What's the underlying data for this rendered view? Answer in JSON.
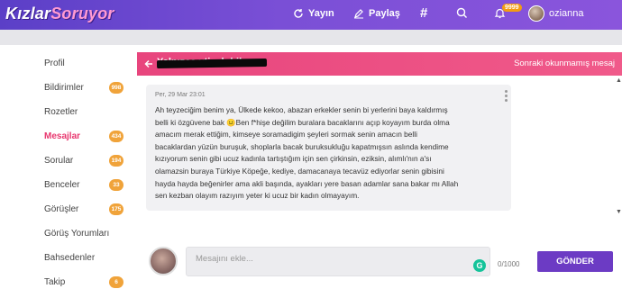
{
  "topbar": {
    "logo_part1": "Kızlar",
    "logo_part2": "Soruyor",
    "nav": {
      "yayin": "Yayın",
      "paylas": "Paylaş",
      "hash": "#"
    },
    "notifications_badge": "9999",
    "username": "ozianna"
  },
  "sidebar": {
    "items": [
      {
        "label": "Profil",
        "badge": ""
      },
      {
        "label": "Bildirimler",
        "badge": "998"
      },
      {
        "label": "Rozetler",
        "badge": ""
      },
      {
        "label": "Mesajlar",
        "badge": "434"
      },
      {
        "label": "Sorular",
        "badge": "194"
      },
      {
        "label": "Benceler",
        "badge": "33"
      },
      {
        "label": "Görüşler",
        "badge": "175"
      },
      {
        "label": "Görüş Yorumları",
        "badge": ""
      },
      {
        "label": "Bahsedenler",
        "badge": ""
      },
      {
        "label": "Takip",
        "badge": "6"
      }
    ]
  },
  "conversation": {
    "title": "Yalnızca ytisch bik",
    "next_unread": "Sonraki okunmamış mesaj",
    "message": {
      "date": "Per, 29 Mar 23:01",
      "lines": [
        "Ah teyzeciğim benim ya, Ülkede kekoo, abazan erkekler senin bi yerlerini baya kaldırmış",
        "belli ki özgüvene bak 😐Ben f*hişe değilim buralara bacaklarını açıp koyayım burda olma",
        "amacım merak ettiğim, kimseye soramadigim şeyleri sormak senin amacın belli",
        "bacaklardan yüzün buruşuk, shoplarla bacak buruksukluğu kapatmışsın aslında kendime",
        "kızıyorum senin gibi ucuz kadınla tartıştığım için sen çirkinsin, eziksin, alımlı'nın a'sı",
        "olamazsin buraya Türkiye Köpeğe, kediye, damacanaya tecavüz ediyorlar senin gibisini",
        "hayda hayda beğenirler ama akli başında, ayakları yere basan adamlar sana bakar mı Allah",
        "sen kezban olayım razıyım yeter ki ucuz bir kadın olmayayım."
      ]
    }
  },
  "composer": {
    "placeholder": "Mesajını ekle...",
    "char_count": "0/1000",
    "send_label": "GÖNDER"
  },
  "colors": {
    "topbar": "#6a45cf",
    "accent_pink": "#e8457d",
    "badge_orange": "#f0a33a",
    "send_purple": "#6c3bc4"
  }
}
